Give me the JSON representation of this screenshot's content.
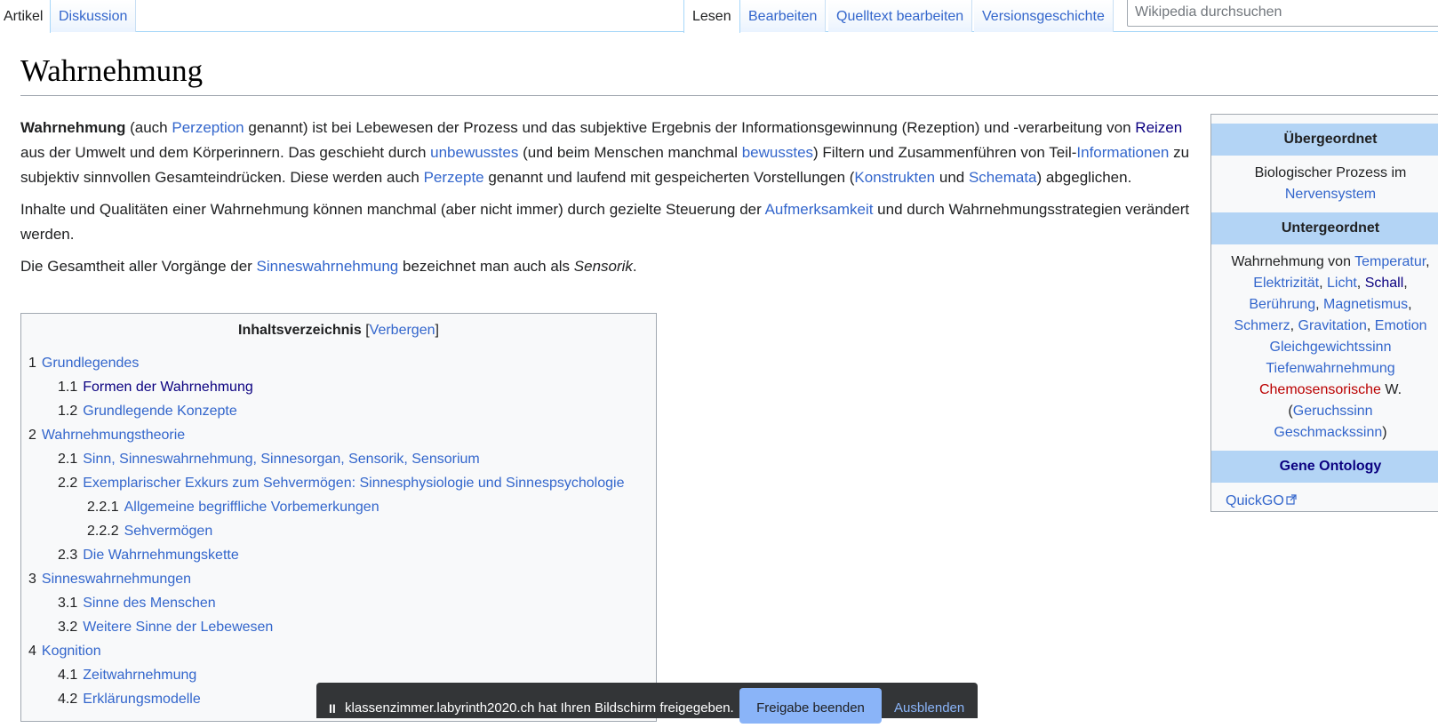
{
  "tabs": {
    "article": "Artikel",
    "discussion": "Diskussion",
    "read": "Lesen",
    "edit": "Bearbeiten",
    "edit_source": "Quelltext bearbeiten",
    "history": "Versionsgeschichte"
  },
  "search": {
    "placeholder": "Wikipedia durchsuchen"
  },
  "page": {
    "title": "Wahrnehmung"
  },
  "intro": {
    "p1": {
      "bold": "Wahrnehmung",
      "t1": " (auch ",
      "l_perzeption": "Perzeption",
      "t2": " genannt) ist bei Lebewesen der Prozess und das subjektive Ergebnis der Informationsgewinnung (Rezeption) und -verarbeitung von ",
      "l_reizen": "Reizen",
      "t3": " aus der Umwelt und dem Körperinnern. Das geschieht durch ",
      "l_unbewusstes": "unbewusstes",
      "t4": " (und beim Menschen manchmal ",
      "l_bewusstes": "bewusstes",
      "t5": ") Filtern und Zusammenführen von Teil-",
      "l_informationen": "Informationen",
      "t6": " zu subjektiv sinnvollen Gesamteindrücken. Diese werden auch ",
      "l_perzepte": "Perzepte",
      "t7": " genannt und laufend mit gespeicherten Vorstellungen (",
      "l_konstrukten": "Konstrukten",
      "t8": " und ",
      "l_schemata": "Schemata",
      "t9": ") abgeglichen."
    },
    "p2": {
      "t1": "Inhalte und Qualitäten einer Wahrnehmung können manchmal (aber nicht immer) durch gezielte Steuerung der ",
      "l_aufmerksamkeit": "Aufmerksamkeit",
      "t2": " und durch Wahrnehmungsstrategien verändert werden."
    },
    "p3": {
      "t1": "Die Gesamtheit aller Vorgänge der ",
      "l_sinnes": "Sinneswahrnehmung",
      "t2": " bezeichnet man auch als ",
      "em": "Sensorik",
      "t3": "."
    }
  },
  "toc": {
    "title": "Inhaltsverzeichnis",
    "bracket_open": "[",
    "toggle": "Verbergen",
    "bracket_close": "]",
    "items": [
      {
        "num": "1",
        "text": "Grundlegendes"
      },
      {
        "num": "1.1",
        "text": "Formen der Wahrnehmung"
      },
      {
        "num": "1.2",
        "text": "Grundlegende Konzepte"
      },
      {
        "num": "2",
        "text": "Wahrnehmungstheorie"
      },
      {
        "num": "2.1",
        "text": "Sinn, Sinneswahrnehmung, Sinnesorgan, Sensorik, Sensorium"
      },
      {
        "num": "2.2",
        "text": "Exemplarischer Exkurs zum Sehvermögen: Sinnesphysiologie und Sinnespsychologie"
      },
      {
        "num": "2.2.1",
        "text": "Allgemeine begriffliche Vorbemerkungen"
      },
      {
        "num": "2.2.2",
        "text": "Sehvermögen"
      },
      {
        "num": "2.3",
        "text": "Die Wahrnehmungskette"
      },
      {
        "num": "3",
        "text": "Sinneswahrnehmungen"
      },
      {
        "num": "3.1",
        "text": "Sinne des Menschen"
      },
      {
        "num": "3.2",
        "text": "Weitere Sinne der Lebewesen"
      },
      {
        "num": "4",
        "text": "Kognition"
      },
      {
        "num": "4.1",
        "text": "Zeitwahrnehmung"
      },
      {
        "num": "4.2",
        "text": "Erklärungsmodelle"
      }
    ]
  },
  "infobox": {
    "h1": "Übergeordnet",
    "b1_text": "Biologischer Prozess im",
    "b1_link": "Nervensystem",
    "h2": "Untergeordnet",
    "b2": {
      "prefix": "Wahrnehmung von ",
      "temperatur": "Temperatur",
      "elektrizitaet": "Elektrizität",
      "licht": "Licht",
      "schall": "Schall",
      "beruehrung": "Berührung",
      "magnetismus": "Magnetismus",
      "schmerz": "Schmerz",
      "gravitation": "Gravitation",
      "emotion": "Emotion",
      "gleichgewicht": "Gleichgewichtssinn",
      "tiefen": "Tiefenwahrnehmung",
      "chemo": "Chemosensorische",
      "w": " W.",
      "paren_open": "(",
      "geruch": "Geruchssinn",
      "geschmack": "Geschmackssinn",
      "paren_close": ")",
      "comma": ","
    },
    "h3": "Gene Ontology",
    "quickgo": "QuickGO"
  },
  "sharebar": {
    "pause": "II",
    "message": "klassenzimmer.labyrinth2020.ch hat Ihren Bildschirm freigegeben.",
    "stop": "Freigabe beenden",
    "hide": "Ausblenden"
  },
  "colors": {
    "link": "#3366cc",
    "visited": "#0b0080",
    "redlink": "#ba0000",
    "infobox_header": "#b3d4f5"
  }
}
